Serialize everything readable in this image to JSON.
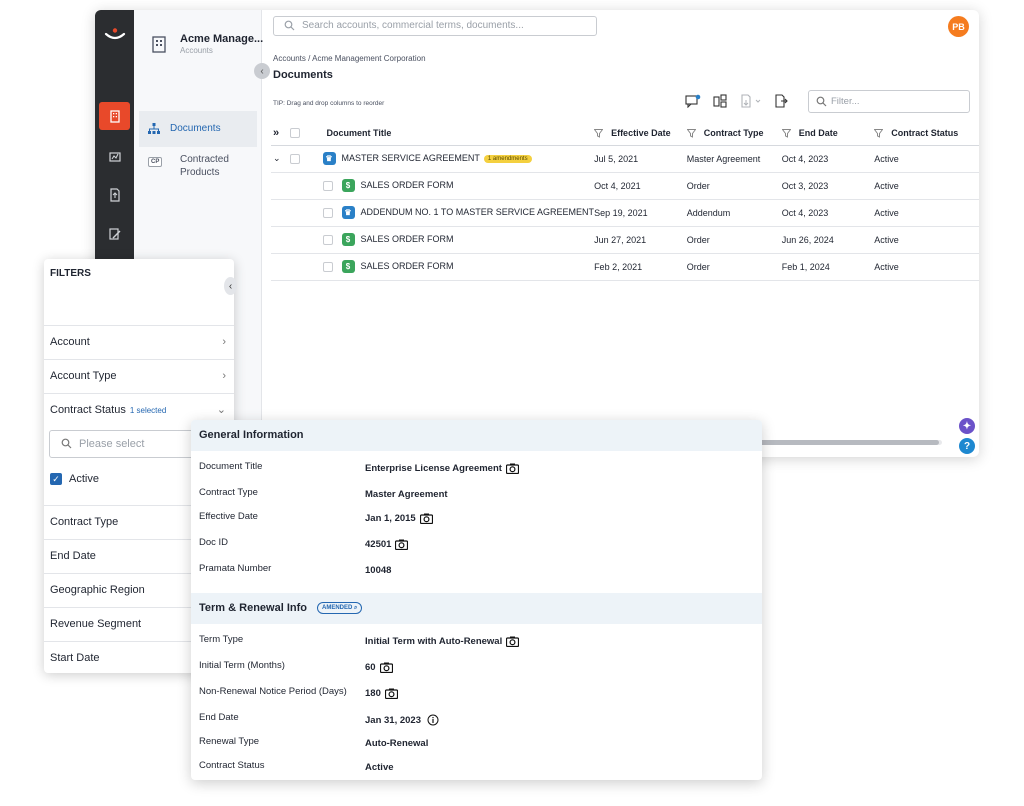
{
  "search": {
    "placeholder": "Search accounts, commercial terms, documents..."
  },
  "user": {
    "initials": "PB"
  },
  "account": {
    "name": "Acme Manage...",
    "sub": "Accounts"
  },
  "nav": [
    {
      "label": "Documents",
      "active": true
    },
    {
      "label": "Contracted Products",
      "badge": "CP"
    }
  ],
  "breadcrumb": "Accounts / Acme Management Corporation",
  "page_title": "Documents",
  "tip": "TIP: Drag and drop columns to reorder",
  "filter_placeholder": "Filter...",
  "columns": [
    "Document Title",
    "Effective Date",
    "Contract Type",
    "End Date",
    "Contract Status"
  ],
  "rows": [
    {
      "title": "MASTER SERVICE AGREEMENT",
      "badge": "1 amendments",
      "icon": "crown-icon",
      "effective": "Jul 5, 2021",
      "type": "Master Agreement",
      "end": "Oct 4, 2023",
      "status": "Active"
    },
    {
      "title": "SALES ORDER FORM",
      "icon": "dollar-icon",
      "effective": "Oct 4, 2021",
      "type": "Order",
      "end": "Oct 3, 2023",
      "status": "Active"
    },
    {
      "title": "ADDENDUM NO. 1 TO MASTER SERVICE AGREEMENT",
      "icon": "crown-icon",
      "effective": "Sep 19, 2021",
      "type": "Addendum",
      "end": "Oct 4, 2023",
      "status": "Active"
    },
    {
      "title": "SALES ORDER FORM",
      "icon": "dollar-icon",
      "effective": "Jun 27, 2021",
      "type": "Order",
      "end": "Jun 26, 2024",
      "status": "Active"
    },
    {
      "title": "SALES ORDER FORM",
      "icon": "dollar-icon",
      "effective": "Feb 2, 2021",
      "type": "Order",
      "end": "Feb 1, 2024",
      "status": "Active"
    }
  ],
  "filters": {
    "title": "FILTERS",
    "items": [
      "Account",
      "Account Type",
      "Contract Status",
      "Contract Type",
      "End Date",
      "Geographic Region",
      "Revenue Segment",
      "Start Date"
    ],
    "contract_status_selected": "1 selected",
    "search_placeholder": "Please select",
    "checked_option": "Active"
  },
  "detail": {
    "general_title": "General Information",
    "general": [
      {
        "label": "Document Title",
        "value": "Enterprise License Agreement",
        "camera": true
      },
      {
        "label": "Contract Type",
        "value": "Master Agreement",
        "camera": false
      },
      {
        "label": "Effective Date",
        "value": "Jan 1, 2015",
        "camera": true
      },
      {
        "label": "Doc ID",
        "value": "42501",
        "camera": true
      },
      {
        "label": "Pramata Number",
        "value": "10048",
        "camera": false
      }
    ],
    "term_title": "Term & Renewal Info",
    "term_badge": "AMENDED",
    "term": [
      {
        "label": "Term Type",
        "value": "Initial Term with Auto-Renewal",
        "camera": true
      },
      {
        "label": "Initial Term (Months)",
        "value": "60",
        "camera": true
      },
      {
        "label": "Non-Renewal Notice Period (Days)",
        "value": "180",
        "camera": true
      },
      {
        "label": "End Date",
        "value": "Jan 31, 2023",
        "camera": false,
        "info": true
      },
      {
        "label": "Renewal Type",
        "value": "Auto-Renewal",
        "camera": false
      },
      {
        "label": "Contract Status",
        "value": "Active",
        "camera": false
      }
    ]
  },
  "colors": {
    "accent": "#e8492a",
    "link": "#2467b1",
    "rail": "#2b2d30",
    "avatar": "#f57c1f",
    "badge": "#f4d03f"
  }
}
